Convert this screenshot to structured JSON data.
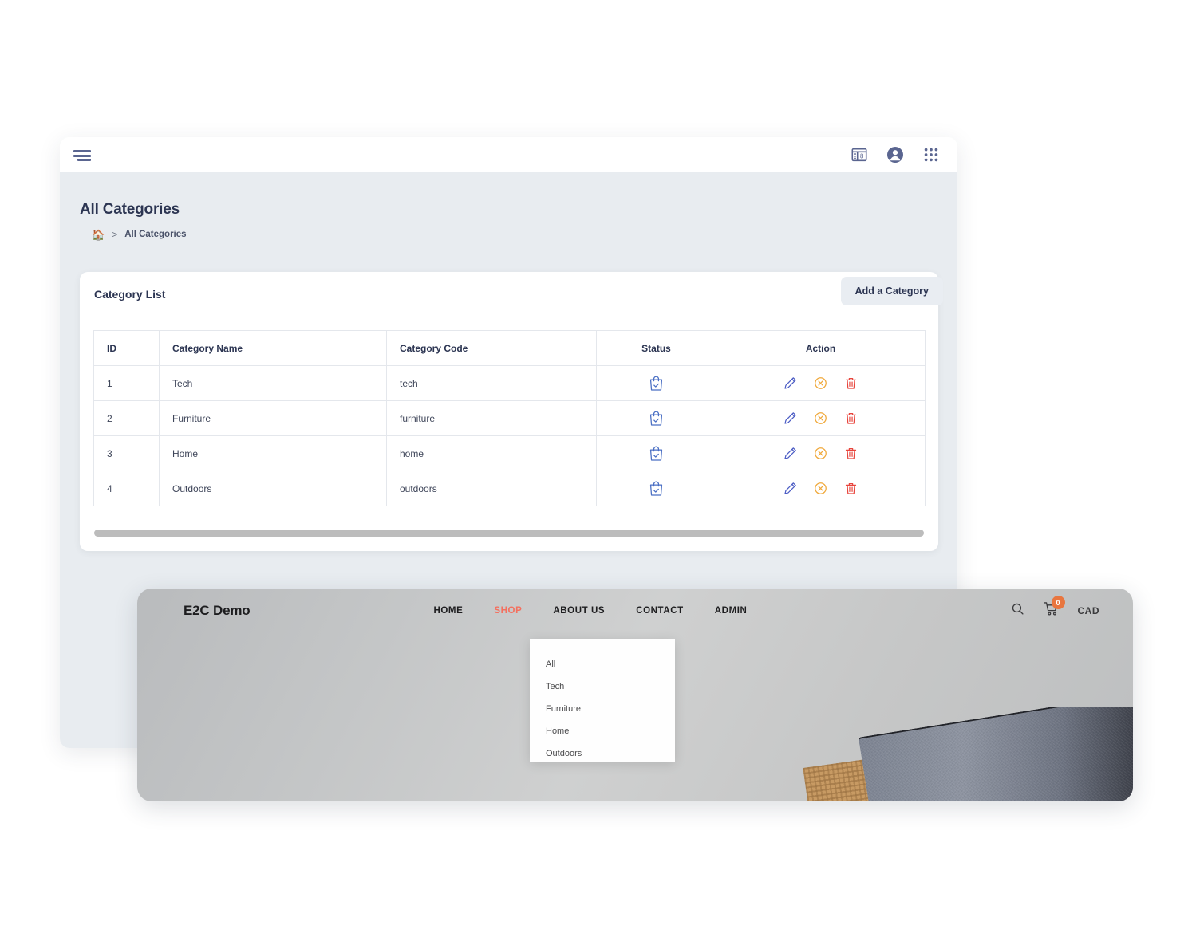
{
  "admin": {
    "topbar": {
      "menu_icon": "hamburger-menu-icon",
      "icons": [
        {
          "name": "calendar-window-icon",
          "label": "8"
        },
        {
          "name": "user-logout-icon",
          "label": ""
        },
        {
          "name": "apps-grid-icon",
          "label": ""
        }
      ]
    },
    "page_title": "All Categories",
    "breadcrumb": {
      "home_icon": "home-icon",
      "separator": ">",
      "current": "All Categories"
    },
    "card": {
      "title": "Category List",
      "add_button": "Add a Category"
    },
    "table": {
      "columns": [
        "ID",
        "Category Name",
        "Category Code",
        "Status",
        "Action"
      ],
      "rows": [
        {
          "id": "1",
          "name": "Tech",
          "code": "tech",
          "status_icon": "shopping-bag-check-icon"
        },
        {
          "id": "2",
          "name": "Furniture",
          "code": "furniture",
          "status_icon": "shopping-bag-check-icon"
        },
        {
          "id": "3",
          "name": "Home",
          "code": "home",
          "status_icon": "shopping-bag-check-icon"
        },
        {
          "id": "4",
          "name": "Outdoors",
          "code": "outdoors",
          "status_icon": "shopping-bag-check-icon"
        }
      ],
      "actions": [
        "edit-pencil-icon",
        "disable-circle-x-icon",
        "delete-trash-icon"
      ]
    }
  },
  "storefront": {
    "brand": "E2C Demo",
    "nav": [
      {
        "label": "HOME",
        "active": false
      },
      {
        "label": "SHOP",
        "active": true
      },
      {
        "label": "ABOUT US",
        "active": false
      },
      {
        "label": "CONTACT",
        "active": false
      },
      {
        "label": "ADMIN",
        "active": false
      }
    ],
    "search_icon": "search-icon",
    "cart_icon": "shopping-cart-icon",
    "cart_badge": "0",
    "currency": "CAD",
    "shop_dropdown": [
      "All",
      "Tech",
      "Furniture",
      "Home",
      "Outdoors"
    ]
  },
  "colors": {
    "accent_coral": "#f4705f",
    "badge_orange": "#e8763f",
    "admin_bg": "#e8ecf0",
    "text_navy": "#2c3552",
    "icon_blue": "#4a6fc4",
    "icon_orange": "#f0a93c",
    "icon_red": "#e8443c"
  }
}
